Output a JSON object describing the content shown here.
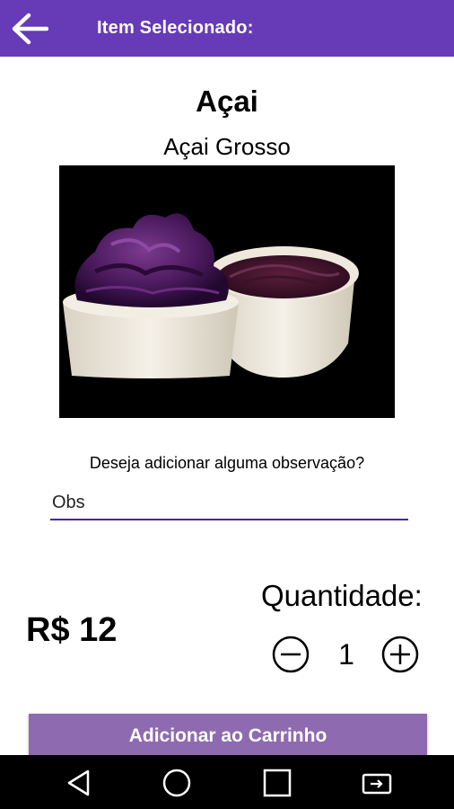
{
  "header": {
    "title": "Item Selecionado:"
  },
  "product": {
    "name": "Açai",
    "variant": "Açai Grosso",
    "price": "R$ 12"
  },
  "observation": {
    "question": "Deseja adicionar alguma observação?",
    "placeholder": "Obs",
    "value": ""
  },
  "quantity": {
    "label": "Quantidade:",
    "value": "1"
  },
  "actions": {
    "add_to_cart": "Adicionar ao Carrinho"
  },
  "colors": {
    "primary": "#673ab7",
    "button": "#8e6bb0",
    "underline": "#4527a0"
  },
  "icons": [
    "arrow-back-icon",
    "minus-circle-icon",
    "plus-circle-icon",
    "nav-back-icon",
    "nav-home-icon",
    "nav-recents-icon",
    "nav-rotate-icon"
  ]
}
